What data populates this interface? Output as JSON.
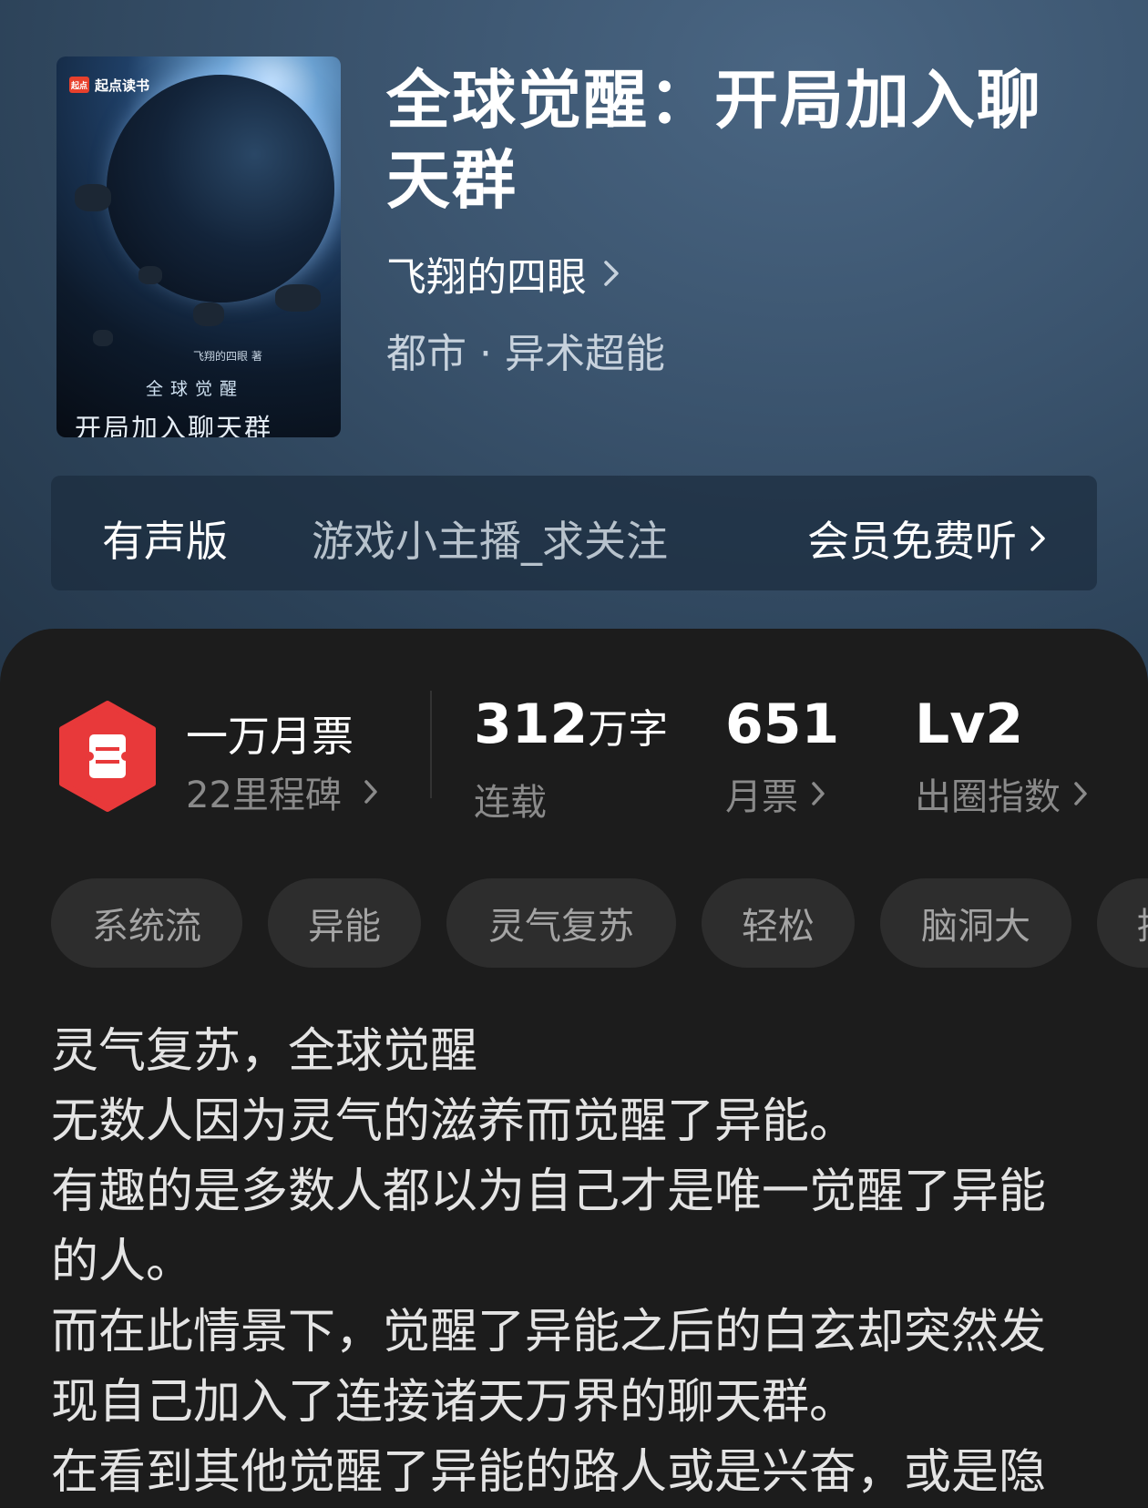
{
  "book": {
    "title": "全球觉醒：开局加入聊天群",
    "author": "飞翔的四眼",
    "genre": "都市 · 异术超能",
    "cover": {
      "publisher_badge": "起点读书",
      "logo_text": "起点",
      "author_line": "飞翔的四眼 著",
      "title_top": "全球觉醒",
      "title_main": "开局加入聊天群"
    }
  },
  "audio": {
    "label": "有声版",
    "narrator": "游戏小主播_求关注",
    "action": "会员免费听",
    "action_icon": "chevron-right-icon"
  },
  "milestone": {
    "title": "一万月票",
    "subtitle": "22里程碑",
    "icon": "ticket-hex-icon",
    "icon_color": "#e8393a"
  },
  "stats": {
    "words": {
      "value": "312",
      "unit": "万字",
      "label": "连载"
    },
    "votes": {
      "value": "651",
      "label": "月票"
    },
    "level": {
      "value": "Lv2",
      "label": "出圈指数"
    }
  },
  "tags": [
    "系统流",
    "异能",
    "灵气复苏",
    "轻松",
    "脑洞大",
    "搞"
  ],
  "description": [
    "灵气复苏，全球觉醒",
    "无数人因为灵气的滋养而觉醒了异能。",
    "有趣的是多数人都以为自己才是唯一觉醒了异能的人。",
    "而在此情景下，觉醒了异能之后的白玄却突然发现自己加入了连接诸天万界的聊天群。",
    "在看到其他觉醒了异能的路人或是兴奋，或是隐"
  ]
}
